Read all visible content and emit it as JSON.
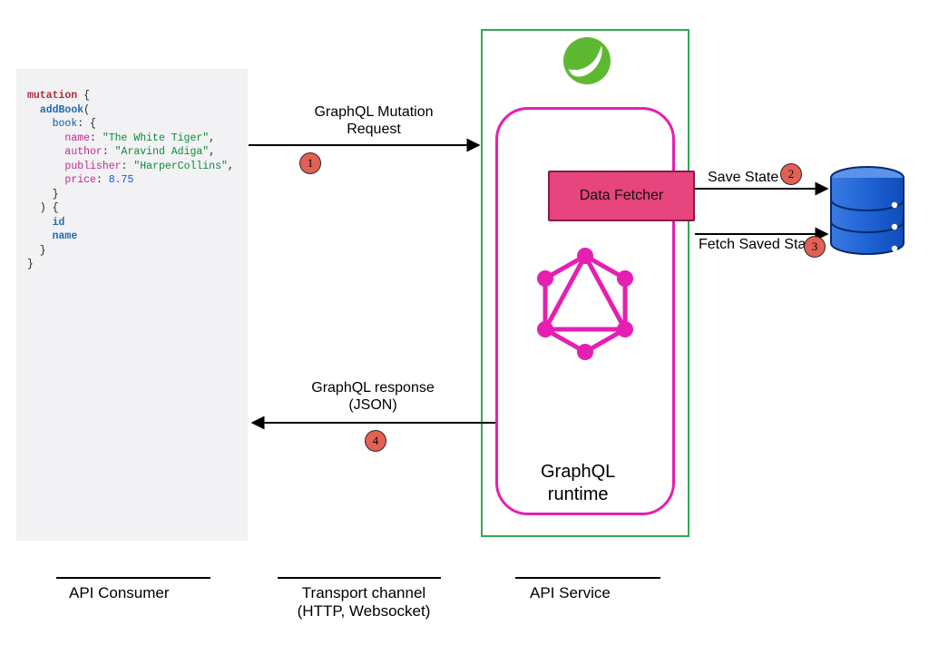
{
  "code": {
    "mutation": "mutation",
    "fnName": "addBook",
    "paramName": "book",
    "fields": {
      "name_key": "name",
      "name_val": "\"The White Tiger\"",
      "author_key": "author",
      "author_val": "\"Aravind Adiga\"",
      "publisher_key": "publisher",
      "publisher_val": "\"HarperCollins\"",
      "price_key": "price",
      "price_val": "8.75"
    },
    "selection": {
      "id": "id",
      "name": "name"
    }
  },
  "labels": {
    "mutation_request_l1": "GraphQL Mutation",
    "mutation_request_l2": "Request",
    "response_l1": "GraphQL response",
    "response_l2": "(JSON)",
    "save_state": "Save State",
    "fetch_saved_state": "Fetch Saved State",
    "data_fetcher": "Data Fetcher",
    "runtime_l1": "GraphQL",
    "runtime_l2": "runtime"
  },
  "steps": {
    "one": "1",
    "two": "2",
    "three": "3",
    "four": "4"
  },
  "footer": {
    "consumer": "API Consumer",
    "transport_l1": "Transport channel",
    "transport_l2": "(HTTP, Websocket)",
    "service": "API Service"
  },
  "colors": {
    "green": "#32a852",
    "magenta": "#e61fb2",
    "pink_fill": "#e6457d",
    "badge": "#e36054",
    "db_blue": "#1f63d6",
    "code_bg": "#f2f2f4"
  }
}
